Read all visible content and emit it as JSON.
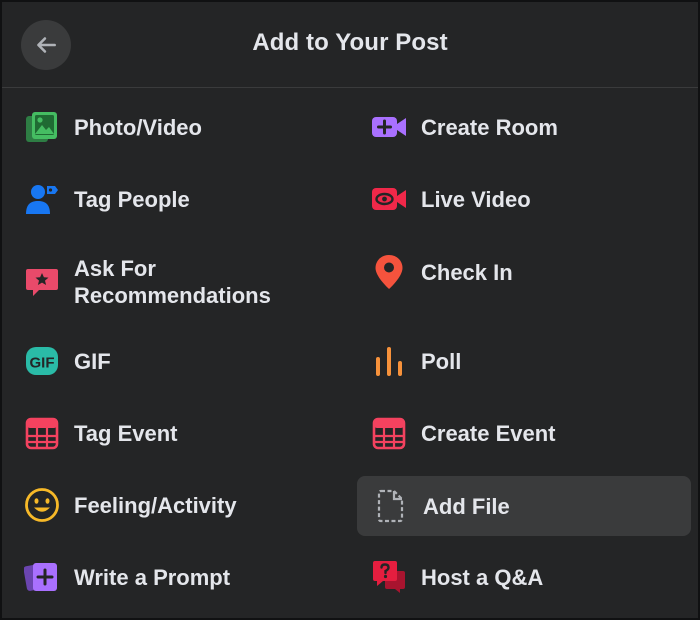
{
  "dialog": {
    "title": "Add to Your Post",
    "back_icon": "arrow-left-icon"
  },
  "options": [
    {
      "label": "Photo/Video",
      "icon": "photo-icon",
      "color": "#45bd62"
    },
    {
      "label": "Create Room",
      "icon": "video-plus-icon",
      "color": "#a970ff"
    },
    {
      "label": "Tag People",
      "icon": "tag-people-icon",
      "color": "#1877f2"
    },
    {
      "label": "Live Video",
      "icon": "live-video-icon",
      "color": "#f02849"
    },
    {
      "label": "Ask For\nRecommendations",
      "icon": "recommendation-star-icon",
      "color": "#e94a6a"
    },
    {
      "label": "Check In",
      "icon": "location-pin-icon",
      "color": "#f5533d"
    },
    {
      "label": "GIF",
      "icon": "gif-icon",
      "color": "#2abba7"
    },
    {
      "label": "Poll",
      "icon": "poll-icon",
      "color": "#f7923b"
    },
    {
      "label": "Tag Event",
      "icon": "calendar-icon",
      "color": "#f3425f"
    },
    {
      "label": "Create Event",
      "icon": "calendar-icon",
      "color": "#f3425f"
    },
    {
      "label": "Feeling/Activity",
      "icon": "smiley-icon",
      "color": "#f7b928"
    },
    {
      "label": "Add File",
      "icon": "file-icon",
      "color": "#b0b3b8"
    },
    {
      "label": "Write a Prompt",
      "icon": "prompt-icon",
      "color": "#a970ff"
    },
    {
      "label": "Host a Q&A",
      "icon": "qa-icon",
      "color": "#e41e3f"
    }
  ]
}
